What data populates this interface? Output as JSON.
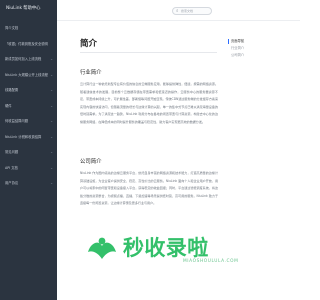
{
  "brand": {
    "name": "NiuLink 帮助中心"
  },
  "search": {
    "placeholder": "搜索文档"
  },
  "sidebar": {
    "items": [
      {
        "label": "简介文档",
        "chevron": false
      },
      {
        "label": "「收银」付款到账及安全说明",
        "chevron": false
      },
      {
        "label": "新成员如何加入上线流程",
        "chevron": true
      },
      {
        "label": "NiuLink 大规模公开上线流程",
        "chevron": true
      },
      {
        "label": "线路配置",
        "chevron": true
      },
      {
        "label": "硬件",
        "chevron": true
      },
      {
        "label": "何收益结算问题",
        "chevron": true
      },
      {
        "label": "NiuLink 计税和收费结算",
        "chevron": true
      },
      {
        "label": "常见问题",
        "chevron": true
      },
      {
        "label": "API 文档",
        "chevron": true
      },
      {
        "label": "用户协议",
        "chevron": true
      }
    ]
  },
  "article": {
    "title": "简介",
    "section1_title": "行业简介",
    "section1_text": "云计算行业一种依托新型专业有价值的信息的云端服务应用，能够提供弹性，便捷，按需的网络资源。随着通信技术的发展，目前整个云数据存储在带宽需求和低延迟的操作，云服务中心的服务器资源不足，带宽成本持续上升，可扩展性差，部署慢等问题开始显现。传统CDN通过服务端的分发缓存方案来实现内容的快速访问，但随着流量的增长与边缘计算的兴起，单一的集中式节点已难以满足海量设备的低时延需求。为了满足这一趋势，NiuLink 利用分布在各地的闲置带宽与计算资源，构建去中心化的边缘服务网络，在降低成本的同时提升服务的覆盖与稳定性，助力客户实现更高效的数据分发。",
    "section2_title": "公司简介",
    "section2_text": "NiuLink 作为国内领先的边缘云服务平台，依托自身丰富的网络资源和技术能力，打造高质量的边缘计算基础设施，为企业客户提供安全、稳定、高性价比的云服务。NiuLink 面向个人和企业用户开放，用户可以将家中的闲置带宽和设备接入平台，获得稳定的收益回报；同时，平台通过智能调度系统，将这些分散的资源整合，为视频点播、直播、下载加速等场景提供低时延、高可用的服务。NiuLink 致力于连接每一份闲置资源，让边缘计算惠及更多行业与用户。"
  },
  "toc": {
    "items": [
      {
        "label": "页面导航",
        "active": true
      },
      {
        "label": "行业简介",
        "active": false
      },
      {
        "label": "公司简介",
        "active": false
      }
    ]
  },
  "watermark": {
    "text": "秒收录啦",
    "sub": "MIAOSHOULULA.COM",
    "color": "#33c06a"
  }
}
